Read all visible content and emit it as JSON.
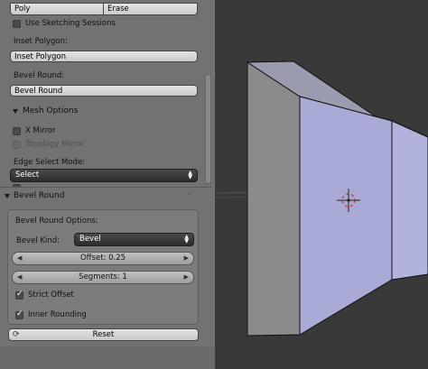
{
  "toolbar_top": {
    "poly_label": "Poly",
    "erase_label": "Erase"
  },
  "sketch": {
    "use_sketching_sessions": "Use Sketching Sessions",
    "inset_polygon_label": "Inset Polygon:",
    "inset_polygon_button": "Inset Polygon",
    "bevel_round_label": "Bevel Round:",
    "bevel_round_button": "Bevel Round"
  },
  "mesh_options": {
    "title": "Mesh Options",
    "x_mirror": "X Mirror",
    "topology_mirror": "Topology Mirror",
    "edge_select_mode_label": "Edge Select Mode:",
    "edge_select_mode_value": "Select"
  },
  "bevel_panel": {
    "title": "Bevel Round",
    "options_label": "Bevel Round Options:",
    "kind_label": "Bevel Kind:",
    "kind_value": "Bevel",
    "offset": "Offset: 0.25",
    "segments": "Segments: 1",
    "strict_offset": "Strict Offset",
    "inner_rounding": "Inner Rounding",
    "reset": "Reset"
  },
  "icons": [
    "chevron-down-icon",
    "checkbox-icon",
    "refresh-icon",
    "drag-grip-icon",
    "3d-cursor-icon"
  ],
  "colors": {
    "panel": "#727272",
    "viewport": "#393939",
    "face_front": "#a9abd6",
    "face_side": "#8a8a8c"
  }
}
